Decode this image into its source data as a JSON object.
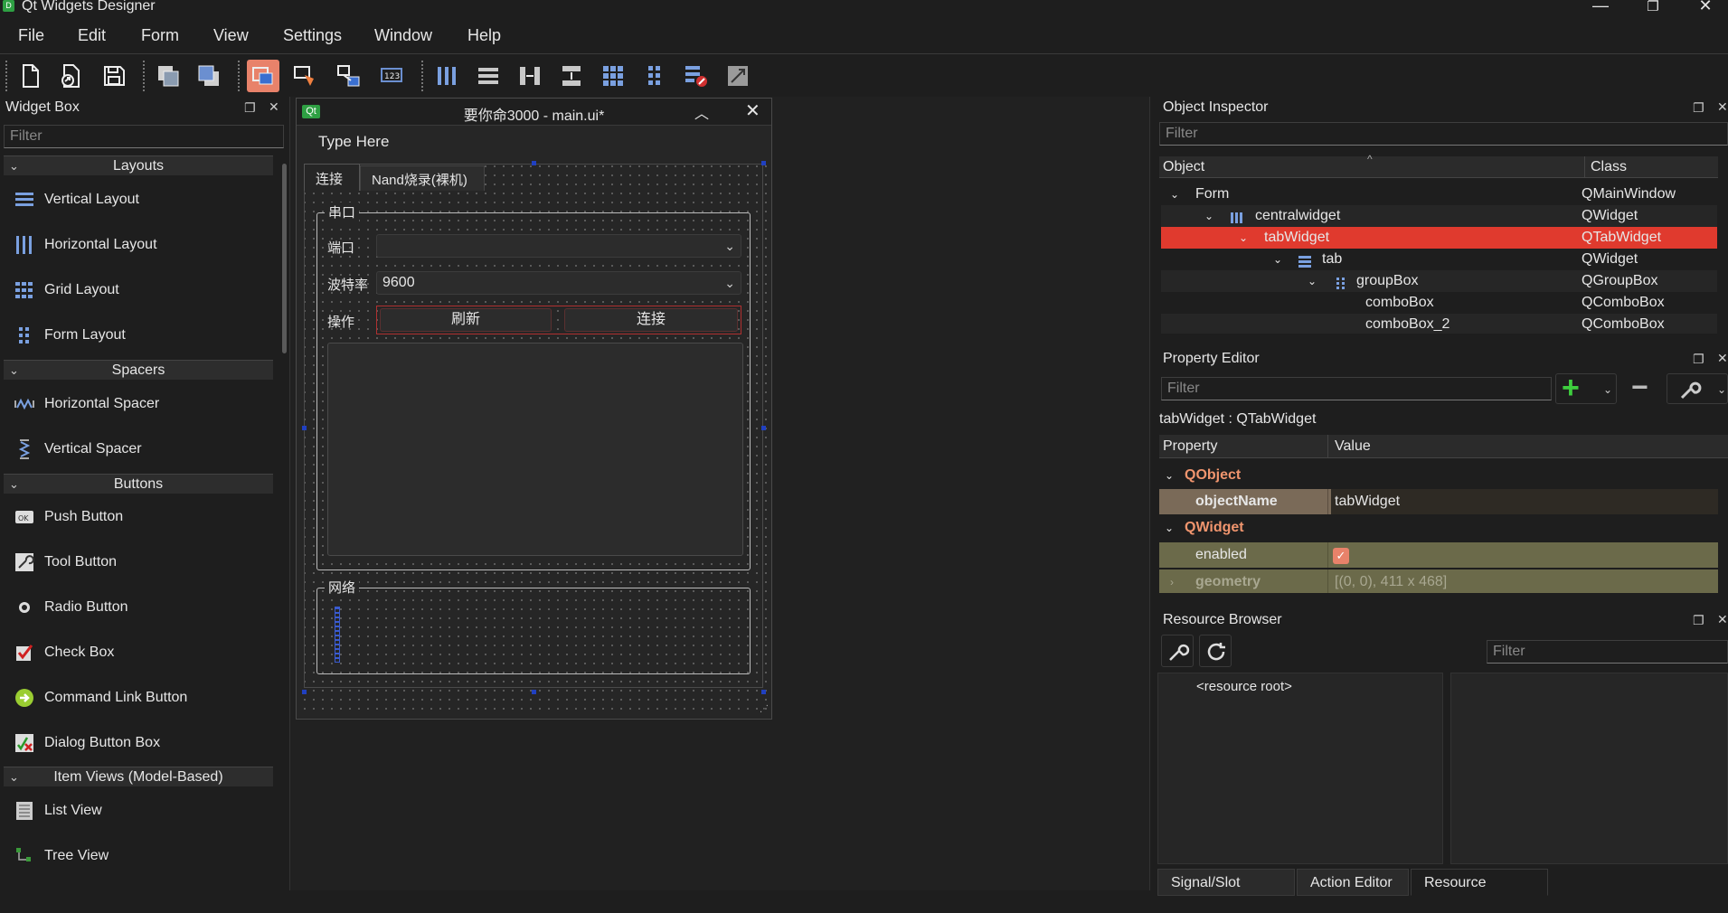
{
  "app": {
    "title": "Qt Widgets Designer",
    "icon_letter": "D",
    "window_controls": {
      "minimize": "—",
      "maximize": "❐",
      "close": "✕"
    }
  },
  "menu": [
    "File",
    "Edit",
    "Form",
    "View",
    "Settings",
    "Window",
    "Help"
  ],
  "toolbar": {
    "icons": [
      "new-form-icon",
      "open-form-icon",
      "save-form-icon",
      "send-to-back-icon",
      "bring-to-front-icon",
      "edit-widgets-icon",
      "edit-signals-slots-icon",
      "edit-buddies-icon",
      "edit-tab-order-icon",
      "lay-out-horizontally-icon",
      "lay-out-vertically-icon",
      "lay-out-horizontal-splitter-icon",
      "lay-out-vertical-splitter-icon",
      "lay-out-grid-icon",
      "lay-out-form-icon",
      "break-layout-icon",
      "adjust-size-icon"
    ],
    "active_index": 5,
    "accent": "#e8826a"
  },
  "widget_box": {
    "title": "Widget Box",
    "filter_placeholder": "Filter",
    "categories": [
      {
        "label": "Layouts",
        "items": [
          "Vertical Layout",
          "Horizontal Layout",
          "Grid Layout",
          "Form Layout"
        ]
      },
      {
        "label": "Spacers",
        "items": [
          "Horizontal Spacer",
          "Vertical Spacer"
        ]
      },
      {
        "label": "Buttons",
        "items": [
          "Push Button",
          "Tool Button",
          "Radio Button",
          "Check Box",
          "Command Link Button",
          "Dialog Button Box"
        ]
      },
      {
        "label": "Item Views (Model-Based)",
        "items": [
          "List View",
          "Tree View"
        ]
      }
    ]
  },
  "form": {
    "window_title": "要你命3000 - main.ui*",
    "qt_badge": "Qt",
    "menu_placeholder": "Type Here",
    "tabs": [
      "连接",
      "Nand烧录(裸机)"
    ],
    "serial_group": {
      "title": "串口",
      "port_label": "端口",
      "port_value": "",
      "baud_label": "波特率",
      "baud_value": "9600",
      "action_label": "操作",
      "refresh_button": "刷新",
      "connect_button": "连接"
    },
    "network_group": {
      "title": "网络"
    }
  },
  "object_inspector": {
    "title": "Object Inspector",
    "filter_placeholder": "Filter",
    "columns": [
      "Object",
      "Class"
    ],
    "rows": [
      {
        "object": "Form",
        "class": "QMainWindow",
        "selected": false
      },
      {
        "object": "centralwidget",
        "class": "QWidget",
        "selected": false
      },
      {
        "object": "tabWidget",
        "class": "QTabWidget",
        "selected": true
      },
      {
        "object": "tab",
        "class": "QWidget",
        "selected": false
      },
      {
        "object": "groupBox",
        "class": "QGroupBox",
        "selected": false
      },
      {
        "object": "comboBox",
        "class": "QComboBox",
        "selected": false
      },
      {
        "object": "comboBox_2",
        "class": "QComboBox",
        "selected": false
      }
    ],
    "selected_color": "#e03a2e"
  },
  "property_editor": {
    "title": "Property Editor",
    "filter_placeholder": "Filter",
    "context": "tabWidget : QTabWidget",
    "columns": [
      "Property",
      "Value"
    ],
    "sections": [
      {
        "name": "QObject",
        "rows": [
          {
            "property": "objectName",
            "value": "tabWidget"
          }
        ]
      },
      {
        "name": "QWidget",
        "rows": [
          {
            "property": "enabled",
            "value": ""
          },
          {
            "property": "geometry",
            "value": "[(0, 0), 411 x 468]"
          }
        ]
      }
    ]
  },
  "resource_browser": {
    "title": "Resource Browser",
    "filter_placeholder": "Filter",
    "root_label": "<resource root>"
  },
  "bottom_tabs": [
    "Signal/Slot Editor",
    "Action Editor",
    "Resource Browser"
  ],
  "bottom_active_tab": "Resource Browser"
}
